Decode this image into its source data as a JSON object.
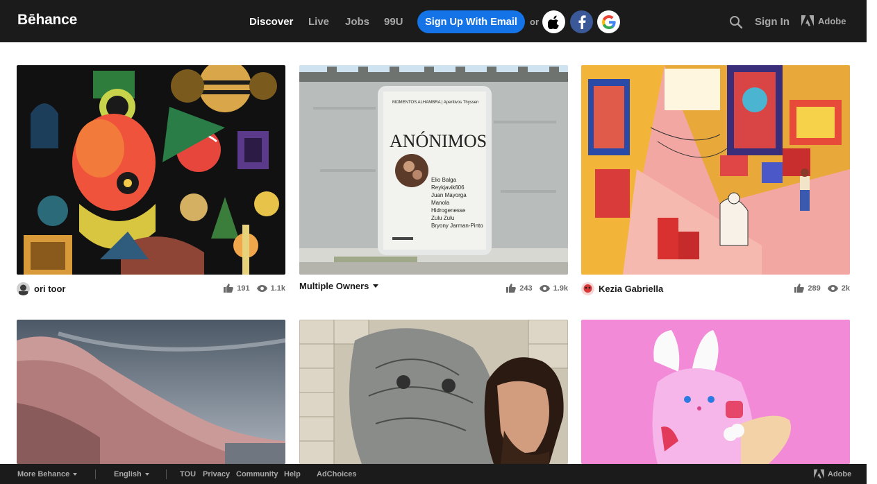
{
  "header": {
    "logo": "Bēhance",
    "nav": [
      "Discover",
      "Live",
      "Jobs",
      "99U"
    ],
    "signup_label": "Sign Up With Email",
    "or_label": "or",
    "signin_label": "Sign In",
    "adobe_label": "Adobe"
  },
  "projects": [
    {
      "owner": "ori toor",
      "appreciations": "191",
      "views": "1.1k"
    },
    {
      "owner": "Multiple Owners",
      "appreciations": "243",
      "views": "1.9k"
    },
    {
      "owner": "Kezia Gabriella",
      "appreciations": "289",
      "views": "2k"
    },
    {
      "owner": "",
      "appreciations": "",
      "views": ""
    },
    {
      "owner": "",
      "appreciations": "",
      "views": ""
    },
    {
      "owner": "",
      "appreciations": "",
      "views": ""
    }
  ],
  "poster": {
    "header": "MOMENTOS ALHAMBRA | Aperitivos Thyssen",
    "title": "ANÓNIMOS",
    "names": [
      "Elio Balga",
      "Reykjavik606",
      "Juan Mayorga",
      "Manola",
      "Hidrogenesse",
      "Zulu Zulu",
      "Bryony Jarman-Pinto"
    ]
  },
  "footer": {
    "more_behance": "More Behance",
    "language": "English",
    "links": [
      "TOU",
      "Privacy",
      "Community",
      "Help"
    ],
    "adchoices": "AdChoices",
    "adobe_label": "Adobe"
  },
  "colors": {
    "header_bg": "#1b1b1b",
    "accent_blue": "#1473e6",
    "facebook_blue": "#3b5998",
    "muted_text": "#a8a8a8"
  },
  "icons": [
    "search-icon",
    "apple-icon",
    "facebook-icon",
    "google-icon",
    "adobe-logo-icon",
    "thumbs-up-icon",
    "eye-icon",
    "caret-down-icon"
  ]
}
